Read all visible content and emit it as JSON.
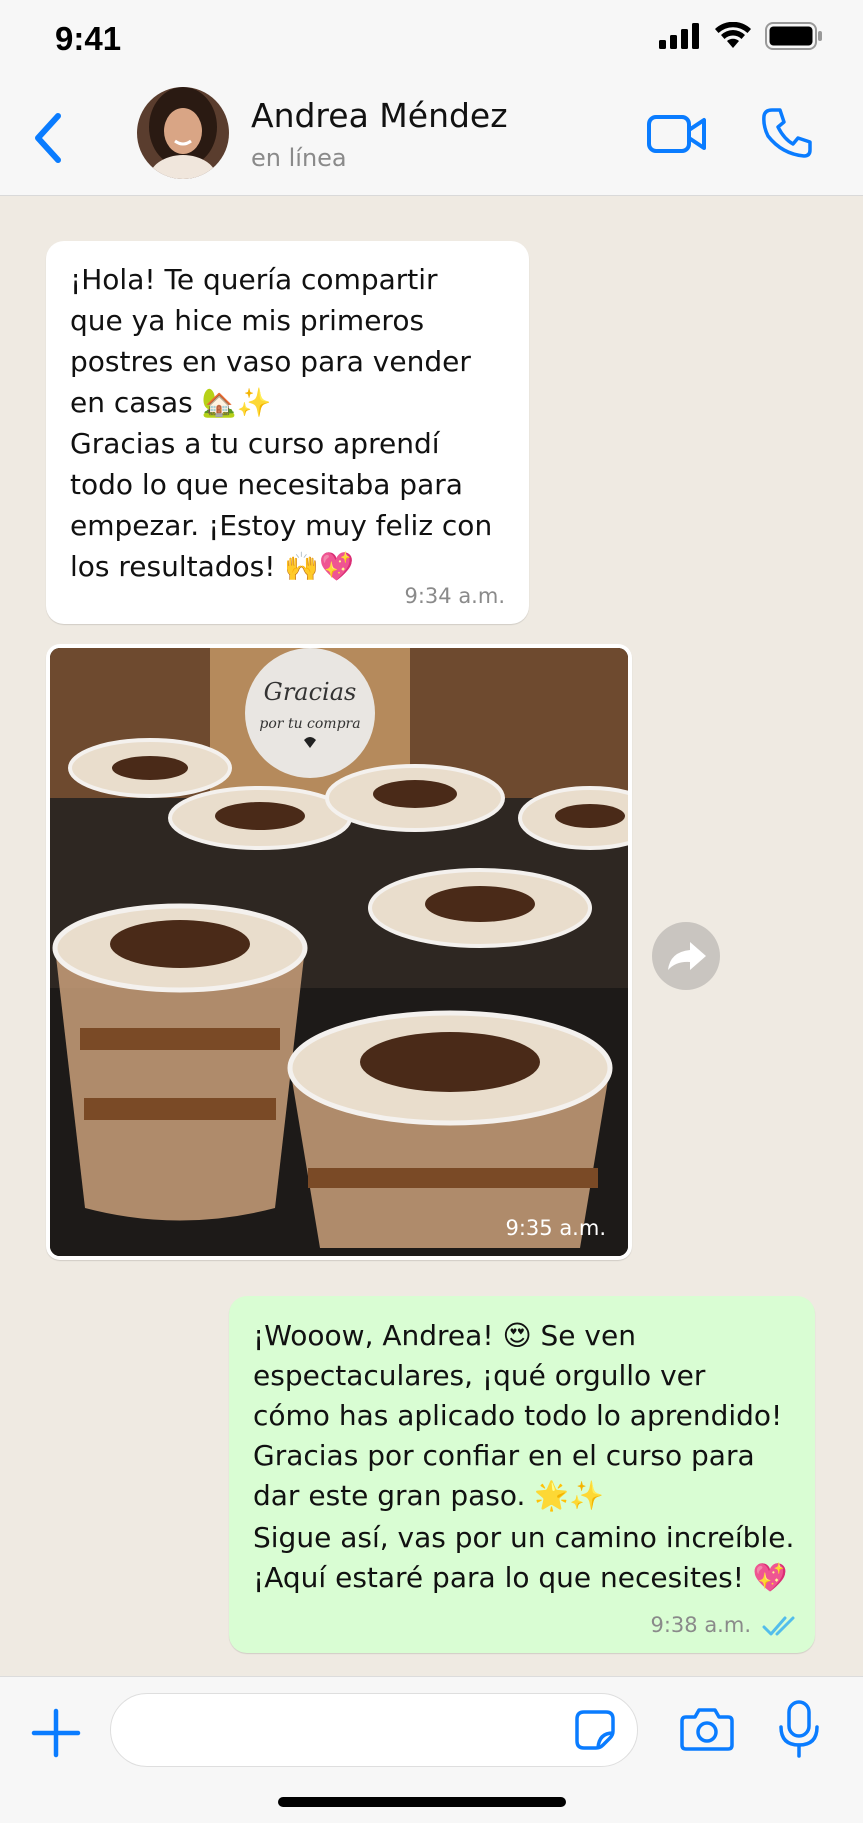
{
  "status_bar": {
    "time": "9:41"
  },
  "header": {
    "contact_name": "Andrea Méndez",
    "contact_status": "en línea"
  },
  "messages": [
    {
      "direction": "incoming",
      "type": "text",
      "text": "¡Hola! Te quería compartir\nque ya hice mis primeros\npostres en vaso para vender\nen casas 🏡✨\nGracias a tu curso aprendí\ntodo lo que necesitaba para\nempezar. ¡Estoy muy feliz con\nlos resultados! 🙌💖",
      "time": "9:34 a.m."
    },
    {
      "direction": "incoming",
      "type": "image",
      "image_sticker_text_1": "Gracias",
      "image_sticker_text_2": "por tu compra",
      "time": "9:35 a.m."
    },
    {
      "direction": "outgoing",
      "type": "text",
      "text": "¡Wooow, Andrea! 😍 Se ven\nespectaculares, ¡qué orgullo ver\ncómo has aplicado todo lo aprendido!\nGracias por confiar en el curso para\ndar este gran paso. 🌟✨",
      "text2": "Sigue así, vas por un camino increíble.\n¡Aquí estaré para lo que necesites! 💖",
      "time": "9:38 a.m.",
      "read_receipt": "double-check-blue"
    }
  ],
  "composer": {
    "placeholder": ""
  },
  "colors": {
    "accent": "#0a7cff",
    "outgoing_bubble": "#d9fdd3",
    "incoming_bubble": "#ffffff",
    "chat_background": "#efeae2",
    "read_receipt": "#53bdeb"
  },
  "icons": {
    "back": "chevron-left-icon",
    "video": "video-camera-icon",
    "call": "phone-icon",
    "forward": "forward-arrow-icon",
    "plus": "plus-icon",
    "sticker": "sticker-icon",
    "camera": "camera-icon",
    "mic": "microphone-icon"
  }
}
